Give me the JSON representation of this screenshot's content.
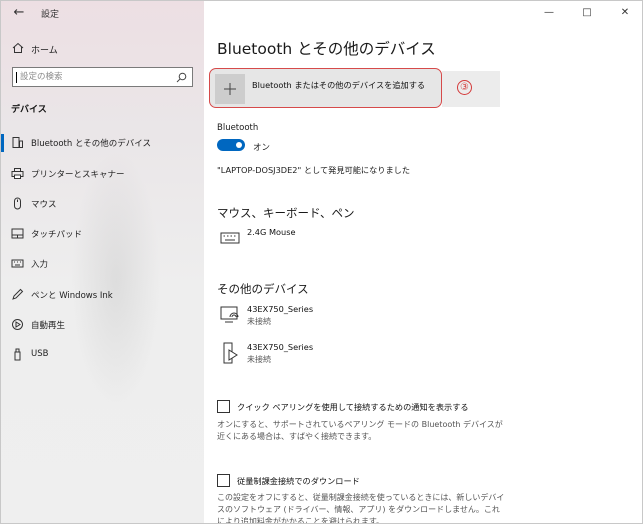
{
  "window": {
    "app_title": "設定",
    "controls": {
      "minimize": "—",
      "maximize": "□",
      "close": "✕"
    }
  },
  "sidebar": {
    "back_icon": "back-arrow-icon",
    "home_label": "ホーム",
    "search_placeholder": "設定の検索",
    "section_label": "デバイス",
    "items": [
      {
        "label": "Bluetooth とその他のデバイス",
        "icon": "bluetooth-devices-icon",
        "selected": true
      },
      {
        "label": "プリンターとスキャナー",
        "icon": "printer-icon",
        "selected": false
      },
      {
        "label": "マウス",
        "icon": "mouse-icon",
        "selected": false
      },
      {
        "label": "タッチパッド",
        "icon": "touchpad-icon",
        "selected": false
      },
      {
        "label": "入力",
        "icon": "keyboard-icon",
        "selected": false
      },
      {
        "label": "ペンと Windows Ink",
        "icon": "pen-icon",
        "selected": false
      },
      {
        "label": "自動再生",
        "icon": "autoplay-icon",
        "selected": false
      },
      {
        "label": "USB",
        "icon": "usb-icon",
        "selected": false
      }
    ]
  },
  "main": {
    "title": "Bluetooth とその他のデバイス",
    "add_device_label": "Bluetooth またはその他のデバイスを追加する",
    "annotation": "③",
    "bluetooth_label": "Bluetooth",
    "bluetooth_state": "オン",
    "discoverable_text": "\"LAPTOP-DOSJ3DE2\" として発見可能になりました",
    "mouse_section": {
      "heading": "マウス、キーボード、ペン",
      "devices": [
        {
          "name": "2.4G Mouse",
          "status": ""
        }
      ]
    },
    "other_section": {
      "heading": "その他のデバイス",
      "devices": [
        {
          "name": "43EX750_Series",
          "status": "未接続"
        },
        {
          "name": "43EX750_Series",
          "status": "未接続"
        }
      ]
    },
    "swift_pair": {
      "label": "クイック ペアリングを使用して接続するための通知を表示する",
      "checked": false,
      "description": "オンにすると、サポートされているペアリング モードの Bluetooth デバイスが近くにある場合は、すばやく接続できます。"
    },
    "metered": {
      "label": "従量制課金接続でのダウンロード",
      "checked": false,
      "description": "この設定をオフにすると、従量制課金接続を使っているときには、新しいデバイスのソフトウェア (ドライバー、情報、アプリ) をダウンロードしません。これにより追加料金がかかることを避けられます。"
    }
  },
  "colors": {
    "accent": "#0067c0",
    "annotation": "#d43a3a"
  }
}
